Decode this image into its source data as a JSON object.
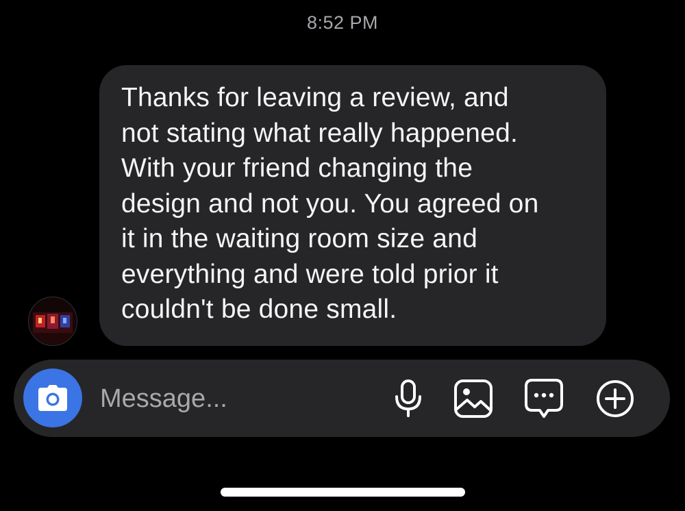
{
  "thread": {
    "timestamp": "8:52 PM"
  },
  "message": {
    "sender_avatar": "avatar-photo",
    "text": "Thanks for leaving a review, and\nnot stating what really happened.\nWith your friend changing the\ndesign and not you. You agreed on\nit in the waiting room size and\neverything and were told prior it\ncouldn't be done small."
  },
  "composer": {
    "placeholder": "Message...",
    "value": "",
    "icons": [
      "camera-icon",
      "microphone-icon",
      "gallery-icon",
      "sticker-icon",
      "plus-icon"
    ]
  },
  "colors": {
    "background": "#000000",
    "bubble": "#262628",
    "composer": "#262628",
    "camera_button": "#3b74e5",
    "secondary_text": "#a8a8ad"
  }
}
